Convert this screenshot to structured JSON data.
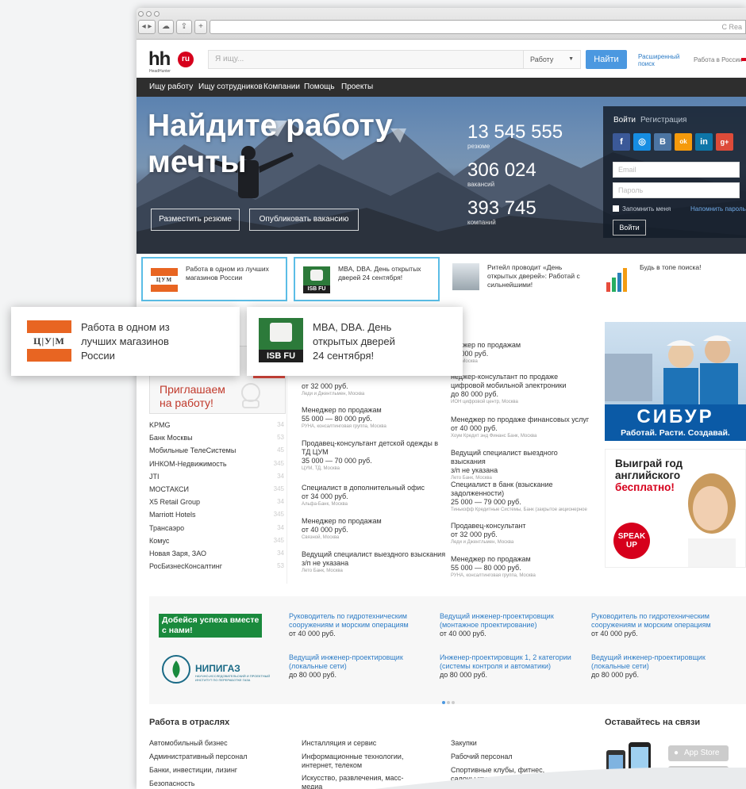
{
  "browser": {
    "reload": "C",
    "url_hint": "Rea"
  },
  "header": {
    "logo_text": "hh",
    "logo_badge": "ru",
    "logo_sub": "HeadHunter",
    "search_placeholder": "Я ищу...",
    "search_scope": "Работу",
    "find_label": "Найти",
    "advanced_label": "Расширенный поиск",
    "region_label": "Работа в России"
  },
  "nav": [
    "Ищу работу",
    "Ищу сотрудников",
    "Компании",
    "Помощь",
    "Проекты"
  ],
  "hero": {
    "title": "Найдите работу мечты",
    "post_resume": "Разместить резюме",
    "post_vacancy": "Опубликовать вакансию",
    "stats": [
      {
        "value": "13 545 555",
        "label": "резюме"
      },
      {
        "value": "306 024",
        "label": "вакансий"
      },
      {
        "value": "393 745",
        "label": "компаний"
      }
    ],
    "login": {
      "tab_login": "Войти",
      "tab_register": "Регистрация",
      "email_placeholder": "Email",
      "password_placeholder": "Пароль",
      "remember": "Запомнить меня",
      "forgot": "Напомнить пароль",
      "submit": "Войти"
    }
  },
  "social": [
    "f",
    "◎",
    "В",
    "ok",
    "in",
    "g+"
  ],
  "promos": [
    {
      "text": "Работа в одном из лучших магазинов России",
      "logo": "ЦУМ"
    },
    {
      "text": "MBA, DBA. День открытых дверей 24 сентября!",
      "logo": "ISB FU"
    },
    {
      "text": "Ритейл проводит «День открытых дверей»: Работай с сильнейшими!"
    },
    {
      "text": "Будь в топе поиска!"
    }
  ],
  "zoom": {
    "tsum_lines": [
      "Работа в одном из",
      "лучших магазинов",
      "России"
    ],
    "isb_lines": [
      "MBA, DBA. День",
      "открытых дверей",
      "24 сентября!"
    ],
    "tsum_logo": "Ц|У|М",
    "isb_logo": "ISB FU"
  },
  "companies_heading_tail": "х",
  "invite": {
    "badge": "of",
    "text": "Приглашаем на работу!"
  },
  "companies": [
    {
      "name": "KPMG",
      "count": "34"
    },
    {
      "name": "Банк Москвы",
      "count": "53"
    },
    {
      "name": "Мобильные ТелеСистемы",
      "count": "45"
    },
    {
      "name": "ИНКОМ-Недвижимость",
      "count": "345"
    },
    {
      "name": "JTI",
      "count": "34"
    },
    {
      "name": "МОСТАКСИ",
      "count": "345"
    },
    {
      "name": "X5 Retail Group",
      "count": "34"
    },
    {
      "name": "Marriott Hotels",
      "count": "345"
    },
    {
      "name": "Трансаэро",
      "count": "34"
    },
    {
      "name": "Комус",
      "count": "345"
    },
    {
      "name": "Новая Заря, ЗАО",
      "count": "34"
    },
    {
      "name": "РосБизнесКонсалтинг",
      "count": "53"
    }
  ],
  "vacancies_mid": [
    {
      "title": "",
      "salary": "от 32 000 руб.",
      "company": "Леди и Джентльмен, Москва"
    },
    {
      "title": "Менеджер по продажам",
      "salary": "55 000 — 80 000 руб.",
      "company": "РУНА, консалтинговая группа, Москва"
    },
    {
      "title": "Продавец-консультант детской одежды в ТД ЦУМ",
      "salary": "35 000 — 70 000 руб.",
      "company": "ЦУМ, ТД, Москва"
    },
    {
      "title": "Специалист в дополнительный офис",
      "salary": "от 34 000 руб.",
      "company": "Альфа-Банк, Москва"
    },
    {
      "title": "Менеджер по продажам",
      "salary": "от 40 000 руб.",
      "company": "Связной, Москва"
    },
    {
      "title": "Ведущий специалист выездного взыскания",
      "salary": "з/п не указана",
      "company": "Лето Банк, Москва"
    }
  ],
  "vacancies_right": [
    {
      "title": "неджер по продажам",
      "salary": "40 000 руб.",
      "company": "ной, Москва"
    },
    {
      "title": "неджер-консультант по продаже цифровой мобильной электроники",
      "salary": "до 80 000 руб.",
      "company": "ИОН цифровой центр, Москва"
    },
    {
      "title": "Менеджер по продаже финансовых услуг",
      "salary": "от 40 000 руб.",
      "company": "Хоум Кредит энд Финанс Банк, Москва"
    },
    {
      "title": "Ведущий специалист выездного взыскания",
      "salary": "з/п не указана",
      "company": "Лето Банк, Москва"
    },
    {
      "title": "Специалист в банк (взыскание задолженности)",
      "salary": "25 000 — 79 000 руб.",
      "company": "Тинькофф Кредитные Системы, Банк (закрытое акционерное"
    },
    {
      "title": "Продавец-консультант",
      "salary": "от 32 000 руб.",
      "company": "Леди и Джентльмен, Москва"
    },
    {
      "title": "Менеджер по продажам",
      "salary": "55 000 — 80 000 руб.",
      "company": "РУНА, консалтинговая группа, Москва"
    }
  ],
  "ads": {
    "sibur_logo": "СИБУР",
    "sibur_slogan": "Работай. Расти. Создавай.",
    "eng_line1": "Выиграй год",
    "eng_line2": "английского",
    "eng_line3": "бесплатно!",
    "speak": "SPEAK",
    "up": "UP"
  },
  "band": {
    "badge_line1": "Добейся успеха вместе",
    "badge_line2": "с нами!",
    "nipigaz": "НИПИГАЗ",
    "nipigaz_sub": "НАУЧНО-ИССЛЕДОВАТЕЛЬСКИЙ И ПРОЕКТНЫЙ ИНСТИТУТ ПО ПЕРЕРАБОТКЕ ГАЗА",
    "vacancies": [
      {
        "title": "Руководитель по гидротехническим сооружениям и морским операциям",
        "salary": "от 40 000 руб."
      },
      {
        "title": "Ведущий инженер-проектировщик (монтажное проектирование)",
        "salary": "от 40 000 руб."
      },
      {
        "title": "Руководитель по гидротехническим сооружениям и морским операциям",
        "salary": "от 40 000 руб."
      },
      {
        "title": "Ведущий инженер-проектировщик (локальные сети)",
        "salary": "до 80 000 руб."
      },
      {
        "title": "Инженер-проектировщик 1, 2 категории (системы контроля и автоматики)",
        "salary": "до 80 000 руб."
      },
      {
        "title": "Ведущий инженер-проектировщик (локальные сети)",
        "salary": "до 80 000 руб."
      }
    ]
  },
  "industries": {
    "heading": "Работа в отраслях",
    "col1": [
      "Автомобильный бизнес",
      "Административный персонал",
      "Банки, инвестиции, лизинг",
      "Безопасность",
      "Бухгалтерия, управленческий учет,"
    ],
    "col2": [
      "Инсталляция и сервис",
      "Информационные технологии, интернет, телеком",
      "Искусство, развлечения, масс-медиа",
      "Консультирование"
    ],
    "col3": [
      "Закупки",
      "Рабочий персонал",
      "Спортивные клубы, фитнес, салоны красоты"
    ]
  },
  "contact": {
    "heading": "Оставайтесь на связи",
    "appstore": "App Store"
  },
  "colors": {
    "accent": "#4b98e0",
    "brand_red": "#d6001c",
    "nav": "#2e2e2e",
    "highlight": "#5bbde6"
  }
}
